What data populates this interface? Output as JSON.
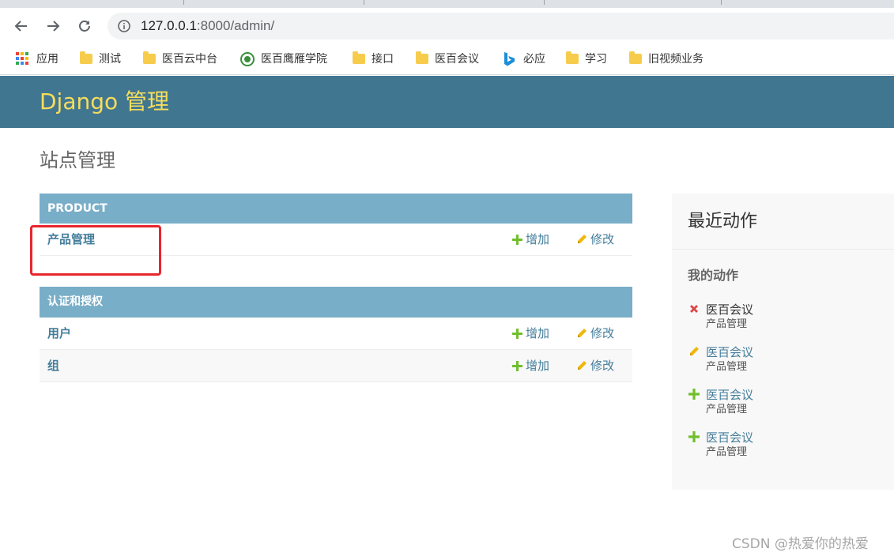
{
  "browser": {
    "url_host": "127.0.0.1",
    "url_rest": ":8000/admin/",
    "bookmarks": [
      {
        "label": "应用",
        "icon": "apps-grid-icon"
      },
      {
        "label": "测试",
        "icon": "folder-icon"
      },
      {
        "label": "医百云中台",
        "icon": "folder-icon"
      },
      {
        "label": "医百鹰雁学院",
        "icon": "site-logo-icon"
      },
      {
        "label": "接口",
        "icon": "folder-icon"
      },
      {
        "label": "医百会议",
        "icon": "folder-icon"
      },
      {
        "label": "必应",
        "icon": "bing-icon"
      },
      {
        "label": "学习",
        "icon": "folder-icon"
      },
      {
        "label": "旧视频业务",
        "icon": "folder-icon"
      }
    ]
  },
  "header": {
    "brand": "Django 管理"
  },
  "page": {
    "title": "站点管理"
  },
  "modules": [
    {
      "caption": "PRODUCT",
      "models": [
        {
          "name": "产品管理",
          "add_label": "增加",
          "change_label": "修改"
        }
      ]
    },
    {
      "caption": "认证和授权",
      "models": [
        {
          "name": "用户",
          "add_label": "增加",
          "change_label": "修改"
        },
        {
          "name": "组",
          "add_label": "增加",
          "change_label": "修改"
        }
      ]
    }
  ],
  "recent_actions": {
    "title": "最近动作",
    "subtitle": "我的动作",
    "items": [
      {
        "name": "医百会议",
        "type": "产品管理",
        "action": "delete",
        "icon": "delete-x-icon"
      },
      {
        "name": "医百会议",
        "type": "产品管理",
        "action": "change",
        "icon": "pencil-icon"
      },
      {
        "name": "医百会议",
        "type": "产品管理",
        "action": "add",
        "icon": "plus-icon"
      },
      {
        "name": "医百会议",
        "type": "产品管理",
        "action": "add",
        "icon": "plus-icon"
      }
    ]
  },
  "watermark": "CSDN @热爱你的热爱",
  "colors": {
    "header_bg": "#417690",
    "brand_text": "#f5dd5d",
    "module_caption_bg": "#79aec8",
    "link": "#447e9b",
    "add_icon": "#70bf2b",
    "change_icon": "#efb80b",
    "delete_icon": "#dd4646",
    "annotation_box": "#e8262d"
  }
}
